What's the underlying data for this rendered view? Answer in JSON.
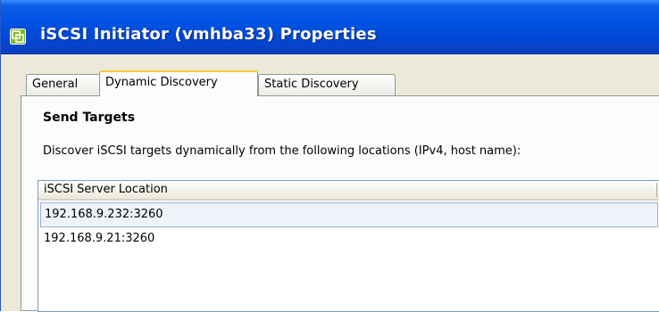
{
  "window": {
    "title": "iSCSI Initiator (vmhba33) Properties",
    "icon": "vsphere-window-icon",
    "colors": {
      "titlebar": "#0054e3",
      "accent_tab": "#ffc83c",
      "face": "#ece9d8"
    }
  },
  "tabs": [
    {
      "label": "General",
      "active": false
    },
    {
      "label": "Dynamic Discovery",
      "active": true
    },
    {
      "label": "Static Discovery",
      "active": false
    }
  ],
  "panel": {
    "section_title": "Send Targets",
    "description": "Discover iSCSI targets dynamically from the following locations (IPv4, host name):"
  },
  "targets_list": {
    "column_header": "iSCSI Server Location",
    "rows": [
      {
        "location": "192.168.9.232:3260",
        "selected": true
      },
      {
        "location": "192.168.9.21:3260",
        "selected": false
      }
    ]
  }
}
